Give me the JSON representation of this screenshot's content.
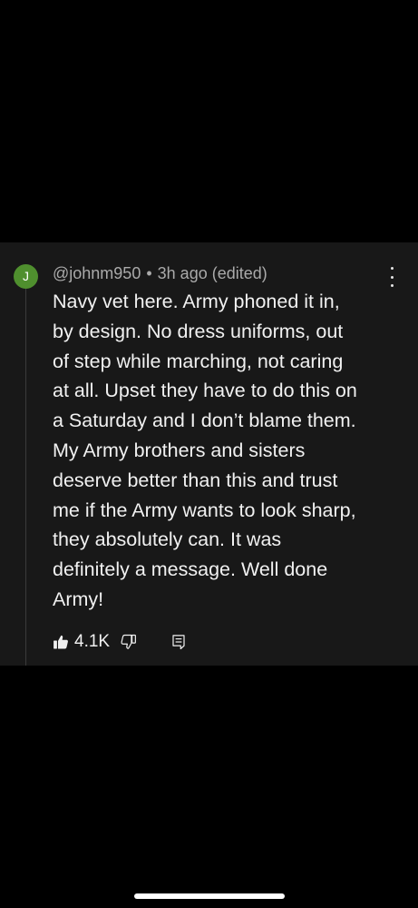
{
  "comment": {
    "avatar_initial": "J",
    "avatar_color": "#4f8f2e",
    "author": "@johnm950",
    "separator": "•",
    "timestamp": "3h ago (edited)",
    "body_lines": [
      "Navy vet here. Army phoned it in,",
      "by design. No dress uniforms, out",
      "of step while marching, not caring",
      "at all. Upset they have to do this on",
      "a Saturday and I don’t blame them.",
      "My Army brothers and sisters",
      "deserve better than this and trust",
      "me if the Army wants to look sharp,",
      "they absolutely can. It was",
      "definitely a message. Well done",
      "Army!"
    ],
    "like_count": "4.1K",
    "icons": {
      "like": "thumbs-up-icon",
      "dislike": "thumbs-down-icon",
      "reply": "reply-icon",
      "menu": "more-vert-icon"
    }
  },
  "colors": {
    "background": "#000000",
    "card": "#181818",
    "text": "#f1f1f1",
    "secondary_text": "#aaaaaa"
  }
}
